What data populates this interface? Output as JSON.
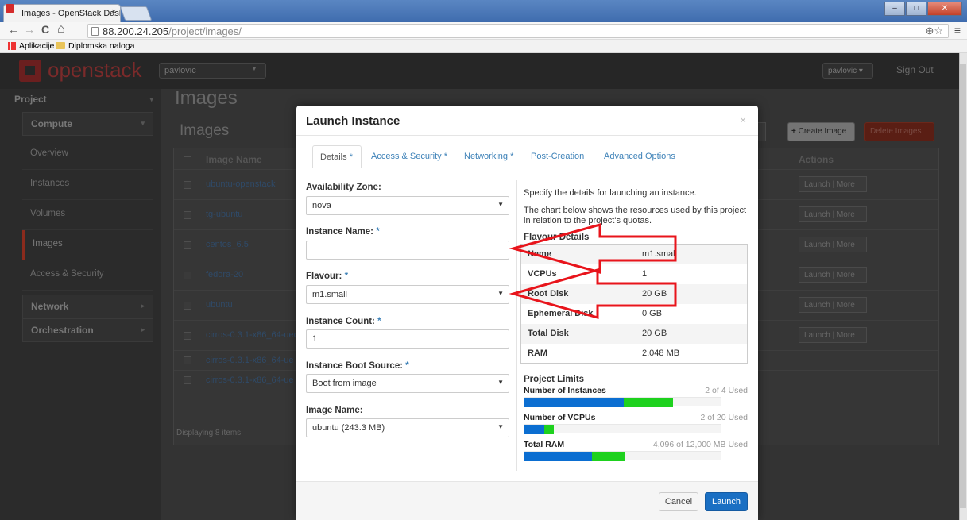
{
  "browser": {
    "tab_title": "Images - OpenStack Dash",
    "tab_close": "×",
    "url_host": "88.200.24.205",
    "url_path": "/project/images/",
    "bookmarks": [
      "Aplikacije",
      "Diplomska naloga"
    ],
    "zoom_icon": "⊕",
    "star_icon": "☆",
    "menu_icon": "≡",
    "nav_back": "←",
    "nav_forward": "→",
    "nav_reload": "C",
    "nav_home": "⌂"
  },
  "header": {
    "logo_text": "openstack",
    "project": "pavlovic",
    "user": "pavlovic",
    "sign_out": "Sign Out"
  },
  "sidebar": {
    "project_label": "Project",
    "compute_label": "Compute",
    "items": [
      "Overview",
      "Instances",
      "Volumes",
      "Images",
      "Access & Security"
    ],
    "network_label": "Network",
    "orchestration_label": "Orchestration"
  },
  "main": {
    "page_title": "Images",
    "panel_title": "Images",
    "create_image": "Create Image",
    "delete_images": "Delete Images",
    "col_image_name": "Image Name",
    "col_actions": "Actions",
    "rows": [
      {
        "name": "ubuntu-openstack",
        "launch": "Launch",
        "more": "More"
      },
      {
        "name": "tg-ubuntu",
        "launch": "Launch",
        "more": "More"
      },
      {
        "name": "centos_6.5",
        "launch": "Launch",
        "more": "More"
      },
      {
        "name": "fedora-20",
        "launch": "Launch",
        "more": "More"
      },
      {
        "name": "ubuntu",
        "launch": "Launch",
        "more": "More"
      },
      {
        "name": "cirros-0.3.1-x86_64-uec",
        "launch": "Launch",
        "more": "More"
      },
      {
        "name": "cirros-0.3.1-x86_64-ue",
        "launch": "",
        "more": ""
      },
      {
        "name": "cirros-0.3.1-x86_64-ue",
        "launch": "",
        "more": ""
      }
    ],
    "footer": "Displaying 8 items"
  },
  "modal": {
    "title": "Launch Instance",
    "close": "×",
    "tabs": [
      "Details",
      "Access & Security",
      "Networking",
      "Post-Creation",
      "Advanced Options"
    ],
    "required_mark": "*",
    "availability_zone_label": "Availability Zone:",
    "availability_zone_value": "nova",
    "instance_name_label": "Instance Name:",
    "instance_name_value": "",
    "flavour_label": "Flavour:",
    "flavour_value": "m1.small",
    "instance_count_label": "Instance Count:",
    "instance_count_value": "1",
    "boot_source_label": "Instance Boot Source:",
    "boot_source_value": "Boot from image",
    "image_name_label": "Image Name:",
    "image_name_value": "ubuntu (243.3 MB)",
    "help_1": "Specify the details for launching an instance.",
    "help_2": "The chart below shows the resources used by this project in relation to the project's quotas.",
    "flavour_details_title": "Flavour Details",
    "flavour_details": [
      {
        "key": "Name",
        "value": "m1.small"
      },
      {
        "key": "VCPUs",
        "value": "1"
      },
      {
        "key": "Root Disk",
        "value": "20 GB"
      },
      {
        "key": "Ephemeral Disk",
        "value": "0 GB"
      },
      {
        "key": "Total Disk",
        "value": "20 GB"
      },
      {
        "key": "RAM",
        "value": "2,048 MB"
      }
    ],
    "project_limits_title": "Project Limits",
    "limits": [
      {
        "label": "Number of Instances",
        "used": "2 of 4 Used",
        "current_fraction": 0.5,
        "added_fraction": 0.25
      },
      {
        "label": "Number of VCPUs",
        "used": "2 of 20 Used",
        "current_fraction": 0.1,
        "added_fraction": 0.05
      },
      {
        "label": "Total RAM",
        "used": "4,096 of 12,000 MB Used",
        "current_fraction": 0.34,
        "added_fraction": 0.17
      }
    ],
    "cancel": "Cancel",
    "launch": "Launch"
  },
  "colors": {
    "accent_blue": "#1a6fc3",
    "bar_blue": "#0b6ed1",
    "bar_green": "#1ed11e",
    "annotation_red": "#e8141b"
  }
}
